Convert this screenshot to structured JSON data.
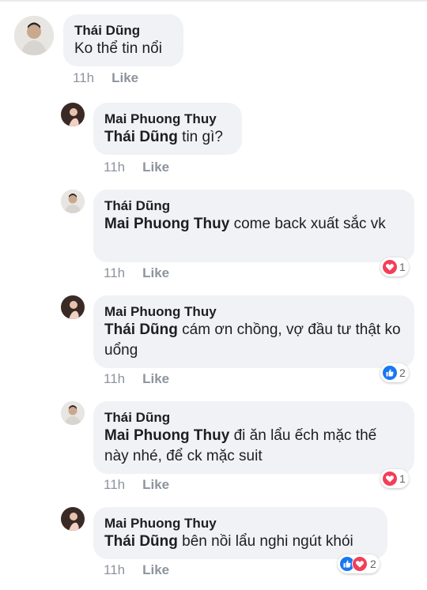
{
  "comments": [
    {
      "author": "Thái Dũng",
      "mention": "",
      "text": "Ko thể tin nổi",
      "time": "11h",
      "like": "Like",
      "reactions": null
    },
    {
      "author": "Mai Phuong Thuy",
      "mention": "Thái Dũng",
      "text": " tin gì?",
      "time": "11h",
      "like": "Like",
      "reactions": null
    },
    {
      "author": "Thái Dũng",
      "mention": "Mai Phuong Thuy",
      "text": " come back xuất sắc vk",
      "time": "11h",
      "like": "Like",
      "reactions": {
        "icons": [
          "heart"
        ],
        "count": "1"
      }
    },
    {
      "author": "Mai Phuong Thuy",
      "mention": "Thái Dũng",
      "text": " cám ơn chồng, vợ đầu tư thật ko uổng",
      "time": "11h",
      "like": "Like",
      "reactions": {
        "icons": [
          "like"
        ],
        "count": "2"
      }
    },
    {
      "author": "Thái Dũng",
      "mention": "Mai Phuong Thuy",
      "text": " đi ăn lẩu ếch mặc thế này nhé, để ck mặc suit",
      "time": "11h",
      "like": "Like",
      "reactions": {
        "icons": [
          "heart"
        ],
        "count": "1"
      }
    },
    {
      "author": "Mai Phuong Thuy",
      "mention": "Thái Dũng",
      "text": " bên nồi lẩu nghi ngút khói",
      "time": "11h",
      "like": "Like",
      "reactions": {
        "icons": [
          "like",
          "heart"
        ],
        "count": "2"
      }
    }
  ],
  "colors": {
    "bubble": "#f0f2f5",
    "meta": "#8d949e",
    "heart": "#f33e58",
    "like": "#1877f2"
  }
}
